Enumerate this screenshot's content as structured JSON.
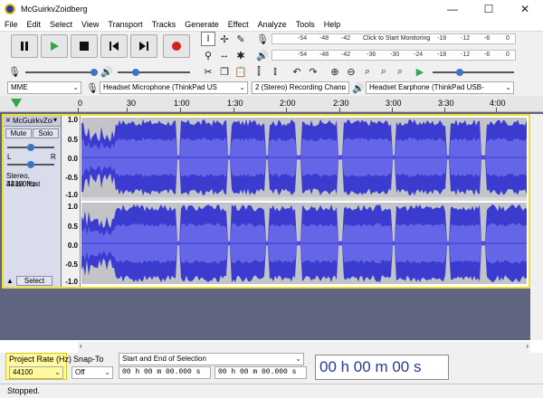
{
  "window": {
    "title": "McGuirkvZoidberg",
    "minimize_glyph": "—",
    "maximize_glyph": "☐",
    "close_glyph": "✕"
  },
  "menu": [
    "File",
    "Edit",
    "Select",
    "View",
    "Transport",
    "Tracks",
    "Generate",
    "Effect",
    "Analyze",
    "Tools",
    "Help"
  ],
  "meter": {
    "top_ticks": [
      "-54",
      "-48",
      "-42",
      "-18",
      "-12",
      "-6",
      "0"
    ],
    "click_text": "Click to Start Monitoring",
    "bottom_ticks": [
      "-54",
      "-48",
      "-42",
      "-36",
      "-30",
      "-24",
      "-18",
      "-12",
      "-6",
      "0"
    ]
  },
  "devices": {
    "host": "MME",
    "recording_device": "Headset Microphone (ThinkPad US",
    "channels": "2 (Stereo) Recording Chann",
    "playback_device": "Headset Earphone (ThinkPad USB-"
  },
  "timeline": {
    "labels": [
      "0",
      "30",
      "1:00",
      "1:30",
      "2:00",
      "2:30",
      "3:00",
      "3:30",
      "4:00"
    ]
  },
  "track": {
    "name": "McGuirkvZoi",
    "mute_label": "Mute",
    "solo_label": "Solo",
    "left_label": "L",
    "right_label": "R",
    "info_line1": "Stereo, 44100Hz",
    "info_line2": "32-bit float",
    "select_label": "Select",
    "close_glyph": "×",
    "ruler": [
      "1.0",
      "0.5",
      "0.0",
      "-0.5",
      "-1.0"
    ]
  },
  "bottom": {
    "project_rate_label": "Project Rate (Hz)",
    "project_rate_value": "44100",
    "snap_to_label": "Snap-To",
    "snap_value": "Off",
    "selection_mode": "Start and End of Selection",
    "sel_start": "00 h 00 m 00.000 s",
    "sel_end": "00 h 00 m 00.000 s",
    "big_time": "00 h 00 m 00 s"
  },
  "status_text": "Stopped.",
  "colors": {
    "waveform": "#3b3bd0",
    "waveform_rms": "#6565e8",
    "selection_highlight": "#f0dc30",
    "play_green": "#2ea84a",
    "record_red": "#d42020"
  }
}
